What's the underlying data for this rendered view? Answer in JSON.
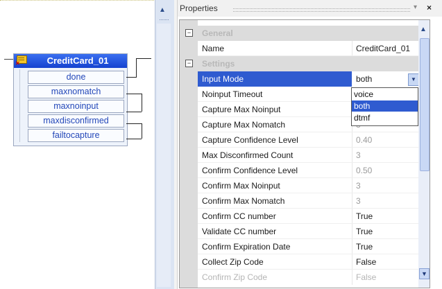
{
  "node": {
    "title": "CreditCard_01",
    "icon": "prompt-node-icon",
    "ports": [
      "done",
      "maxnomatch",
      "maxnoinput",
      "maxdisconfirmed",
      "failtocapture"
    ]
  },
  "properties": {
    "title": "Properties",
    "close": "×",
    "categories": {
      "general": "General",
      "settings": "Settings"
    },
    "rows": [
      {
        "name": "Name",
        "value": "CreditCard_01"
      },
      {
        "name": "Input Mode",
        "value": "both"
      },
      {
        "name": "Noinput Timeout",
        "value": ""
      },
      {
        "name": "Capture Max Noinput",
        "value": ""
      },
      {
        "name": "Capture Max Nomatch",
        "value": "3"
      },
      {
        "name": "Capture Confidence Level",
        "value": "0.40"
      },
      {
        "name": "Max Disconfirmed Count",
        "value": "3"
      },
      {
        "name": "Confirm Confidence Level",
        "value": "0.50"
      },
      {
        "name": "Confirm Max Noinput",
        "value": "3"
      },
      {
        "name": "Confirm Max Nomatch",
        "value": "3"
      },
      {
        "name": "Confirm CC number",
        "value": "True"
      },
      {
        "name": "Validate CC number",
        "value": "True"
      },
      {
        "name": "Confirm Expiration Date",
        "value": "True"
      },
      {
        "name": "Collect Zip Code",
        "value": "False"
      },
      {
        "name": "Confirm Zip Code",
        "value": "False"
      }
    ],
    "dropdown": {
      "options": [
        "voice",
        "both",
        "dtmf"
      ],
      "selected": "both"
    }
  },
  "colors": {
    "selection": "#2f5bd0",
    "node_header": "#1f4fd6",
    "port_text": "#2347b8"
  }
}
